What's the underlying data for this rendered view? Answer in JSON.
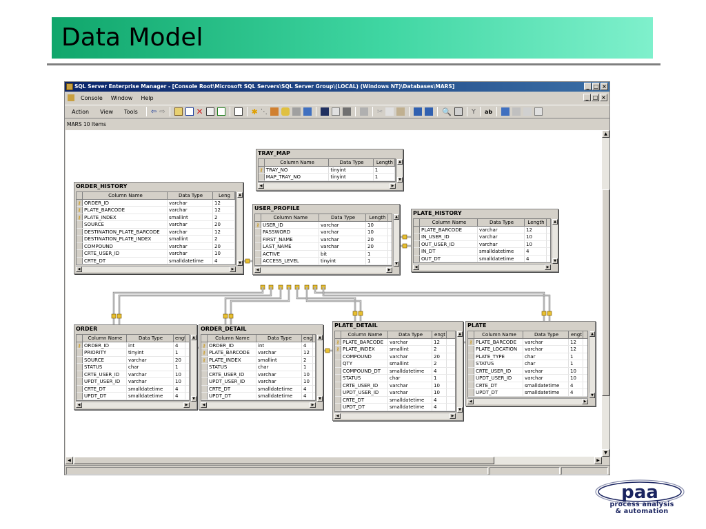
{
  "slide": {
    "title": "Data Model",
    "logo_word": "paa",
    "logo_tagline_1": "process analysis",
    "logo_tagline_2": "& automation"
  },
  "window": {
    "title": "SQL Server Enterprise Manager - [Console Root\\Microsoft SQL Servers\\SQL Server Group\\(LOCAL) (Windows NT)\\Databases\\MARS]",
    "menus": [
      "Console",
      "Window",
      "Help"
    ],
    "action_menus": [
      "Action",
      "View",
      "Tools"
    ],
    "status_text": "MARS    10 Items",
    "accent": "#0a246a"
  },
  "tables": {
    "tray_map": {
      "name": "TRAY_MAP",
      "headers": [
        "Column Name",
        "Data Type",
        "Length"
      ],
      "rows": [
        {
          "key": true,
          "col": "TRAY_NO",
          "type": "tinyint",
          "len": "1"
        },
        {
          "key": false,
          "col": "MAP_TRAY_NO",
          "type": "tinyint",
          "len": "1"
        }
      ]
    },
    "order_history": {
      "name": "ORDER_HISTORY",
      "headers": [
        "Column Name",
        "Data Type",
        "Leng"
      ],
      "rows": [
        {
          "key": true,
          "col": "ORDER_ID",
          "type": "varchar",
          "len": "12"
        },
        {
          "key": true,
          "col": "PLATE_BARCODE",
          "type": "varchar",
          "len": "12"
        },
        {
          "key": true,
          "col": "PLATE_INDEX",
          "type": "smallint",
          "len": "2"
        },
        {
          "key": false,
          "col": "SOURCE",
          "type": "varchar",
          "len": "20"
        },
        {
          "key": false,
          "col": "DESTINATION_PLATE_BARCODE",
          "type": "varchar",
          "len": "12"
        },
        {
          "key": false,
          "col": "DESTINATION_PLATE_INDEX",
          "type": "smallint",
          "len": "2"
        },
        {
          "key": false,
          "col": "COMPOUND",
          "type": "varchar",
          "len": "20"
        },
        {
          "key": false,
          "col": "CRTE_USER_ID",
          "type": "varchar",
          "len": "10"
        },
        {
          "key": false,
          "col": "CRTE_DT",
          "type": "smalldatetime",
          "len": "4"
        }
      ]
    },
    "user_profile": {
      "name": "USER_PROFILE",
      "headers": [
        "Column Name",
        "Data Type",
        "Length"
      ],
      "rows": [
        {
          "key": true,
          "col": "USER_ID",
          "type": "varchar",
          "len": "10"
        },
        {
          "key": false,
          "col": "PASSWORD",
          "type": "varchar",
          "len": "10"
        },
        {
          "key": false,
          "col": "FIRST_NAME",
          "type": "varchar",
          "len": "20"
        },
        {
          "key": false,
          "col": "LAST_NAME",
          "type": "varchar",
          "len": "20"
        },
        {
          "key": false,
          "col": "ACTIVE",
          "type": "bit",
          "len": "1"
        },
        {
          "key": false,
          "col": "ACCESS_LEVEL",
          "type": "tinyint",
          "len": "1"
        }
      ]
    },
    "plate_history": {
      "name": "PLATE_HISTORY",
      "headers": [
        "Column Name",
        "Data Type",
        "Length"
      ],
      "rows": [
        {
          "key": false,
          "col": "PLATE_BARCODE",
          "type": "varchar",
          "len": "12"
        },
        {
          "key": false,
          "col": "IN_USER_ID",
          "type": "varchar",
          "len": "10"
        },
        {
          "key": false,
          "col": "OUT_USER_ID",
          "type": "varchar",
          "len": "10"
        },
        {
          "key": false,
          "col": "IN_DT",
          "type": "smalldatetime",
          "len": "4"
        },
        {
          "key": false,
          "col": "OUT_DT",
          "type": "smalldatetime",
          "len": "4"
        }
      ]
    },
    "order": {
      "name": "ORDER",
      "headers": [
        "Column Name",
        "Data Type",
        "engt"
      ],
      "rows": [
        {
          "key": true,
          "col": "ORDER_ID",
          "type": "int",
          "len": "4"
        },
        {
          "key": false,
          "col": "PRIORITY",
          "type": "tinyint",
          "len": "1"
        },
        {
          "key": false,
          "col": "SOURCE",
          "type": "varchar",
          "len": "20"
        },
        {
          "key": false,
          "col": "STATUS",
          "type": "char",
          "len": "1"
        },
        {
          "key": false,
          "col": "CRTE_USER_ID",
          "type": "varchar",
          "len": "10"
        },
        {
          "key": false,
          "col": "UPDT_USER_ID",
          "type": "varchar",
          "len": "10"
        },
        {
          "key": false,
          "col": "CRTE_DT",
          "type": "smalldatetime",
          "len": "4"
        },
        {
          "key": false,
          "col": "UPDT_DT",
          "type": "smalldatetime",
          "len": "4"
        }
      ]
    },
    "order_detail": {
      "name": "ORDER_DETAIL",
      "headers": [
        "Column Name",
        "Data Type",
        "eng"
      ],
      "rows": [
        {
          "key": true,
          "col": "ORDER_ID",
          "type": "int",
          "len": "4"
        },
        {
          "key": true,
          "col": "PLATE_BARCODE",
          "type": "varchar",
          "len": "12"
        },
        {
          "key": true,
          "col": "PLATE_INDEX",
          "type": "smallint",
          "len": "2"
        },
        {
          "key": false,
          "col": "STATUS",
          "type": "char",
          "len": "1"
        },
        {
          "key": false,
          "col": "CRTE_USER_ID",
          "type": "varchar",
          "len": "10"
        },
        {
          "key": false,
          "col": "UPDT_USER_ID",
          "type": "varchar",
          "len": "10"
        },
        {
          "key": false,
          "col": "CRTE_DT",
          "type": "smalldatetime",
          "len": "4"
        },
        {
          "key": false,
          "col": "UPDT_DT",
          "type": "smalldatetime",
          "len": "4"
        }
      ]
    },
    "plate_detail": {
      "name": "PLATE_DETAIL",
      "headers": [
        "Column Name",
        "Data Type",
        "engt"
      ],
      "rows": [
        {
          "key": true,
          "col": "PLATE_BARCODE",
          "type": "varchar",
          "len": "12"
        },
        {
          "key": true,
          "col": "PLATE_INDEX",
          "type": "smallint",
          "len": "2"
        },
        {
          "key": false,
          "col": "COMPOUND",
          "type": "varchar",
          "len": "20"
        },
        {
          "key": false,
          "col": "QTY",
          "type": "smallint",
          "len": "2"
        },
        {
          "key": false,
          "col": "COMPOUND_DT",
          "type": "smalldatetime",
          "len": "4"
        },
        {
          "key": false,
          "col": "STATUS",
          "type": "char",
          "len": "1"
        },
        {
          "key": false,
          "col": "CRTE_USER_ID",
          "type": "varchar",
          "len": "10"
        },
        {
          "key": false,
          "col": "UPDT_USER_ID",
          "type": "varchar",
          "len": "10"
        },
        {
          "key": false,
          "col": "CRTE_DT",
          "type": "smalldatetime",
          "len": "4"
        },
        {
          "key": false,
          "col": "UPDT_DT",
          "type": "smalldatetime",
          "len": "4"
        }
      ]
    },
    "plate": {
      "name": "PLATE",
      "headers": [
        "Column Name",
        "Data Type",
        "engt"
      ],
      "rows": [
        {
          "key": true,
          "col": "PLATE_BARCODE",
          "type": "varchar",
          "len": "12"
        },
        {
          "key": false,
          "col": "PLATE_LOCATION",
          "type": "varchar",
          "len": "12"
        },
        {
          "key": false,
          "col": "PLATE_TYPE",
          "type": "char",
          "len": "1"
        },
        {
          "key": false,
          "col": "STATUS",
          "type": "char",
          "len": "1"
        },
        {
          "key": false,
          "col": "CRTE_USER_ID",
          "type": "varchar",
          "len": "10"
        },
        {
          "key": false,
          "col": "UPDT_USER_ID",
          "type": "varchar",
          "len": "10"
        },
        {
          "key": false,
          "col": "CRTE_DT",
          "type": "smalldatetime",
          "len": "4"
        },
        {
          "key": false,
          "col": "UPDT_DT",
          "type": "smalldatetime",
          "len": "4"
        }
      ]
    }
  }
}
